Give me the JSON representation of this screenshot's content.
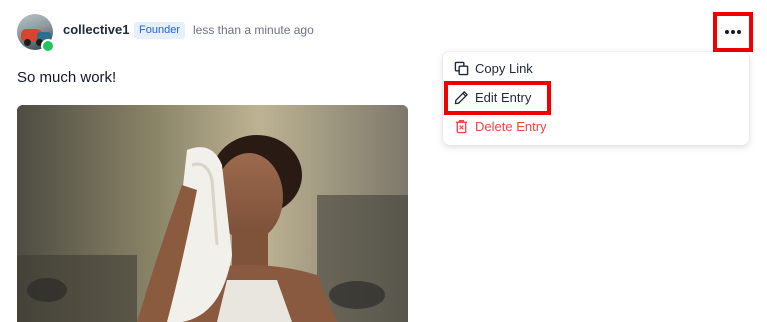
{
  "post": {
    "author": "collective1",
    "role_badge": "Founder",
    "timestamp": "less than a minute ago",
    "content": "So much work!"
  },
  "menu": {
    "items": [
      {
        "label": "Copy Link",
        "icon": "copy-icon"
      },
      {
        "label": "Edit Entry",
        "icon": "pencil-icon"
      },
      {
        "label": "Delete Entry",
        "icon": "trash-icon"
      }
    ]
  },
  "colors": {
    "accent": "#2563eb",
    "badge_bg": "#e6effd",
    "danger": "#ef4444",
    "highlight": "#f10000",
    "online": "#22c55e"
  }
}
